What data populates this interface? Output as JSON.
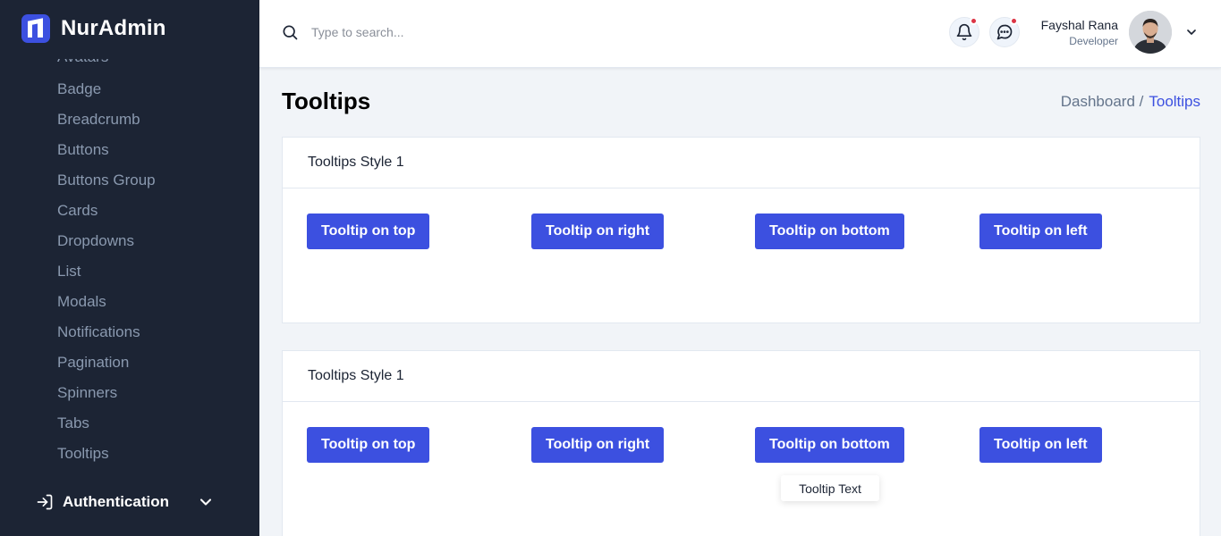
{
  "brand": {
    "name": "NurAdmin"
  },
  "sidebar": {
    "items": [
      {
        "label": "Avatars"
      },
      {
        "label": "Badge"
      },
      {
        "label": "Breadcrumb"
      },
      {
        "label": "Buttons"
      },
      {
        "label": "Buttons Group"
      },
      {
        "label": "Cards"
      },
      {
        "label": "Dropdowns"
      },
      {
        "label": "List"
      },
      {
        "label": "Modals"
      },
      {
        "label": "Notifications"
      },
      {
        "label": "Pagination"
      },
      {
        "label": "Spinners"
      },
      {
        "label": "Tabs"
      },
      {
        "label": "Tooltips"
      }
    ],
    "auth_label": "Authentication"
  },
  "header": {
    "search_placeholder": "Type to search...",
    "user_name": "Fayshal Rana",
    "user_role": "Developer"
  },
  "page": {
    "title": "Tooltips",
    "breadcrumb_parent": "Dashboard /",
    "breadcrumb_current": "Tooltips"
  },
  "cards": [
    {
      "title": "Tooltips Style 1",
      "buttons": [
        "Tooltip on top",
        "Tooltip on right",
        "Tooltip on bottom",
        "Tooltip on left"
      ]
    },
    {
      "title": "Tooltips Style 1",
      "buttons": [
        "Tooltip on top",
        "Tooltip on right",
        "Tooltip on bottom",
        "Tooltip on left"
      ]
    }
  ],
  "tooltip": {
    "text": "Tooltip Text"
  },
  "colors": {
    "sidebar_bg": "#1c2434",
    "primary": "#3c50e0",
    "notification_dot": "#dc3545"
  }
}
